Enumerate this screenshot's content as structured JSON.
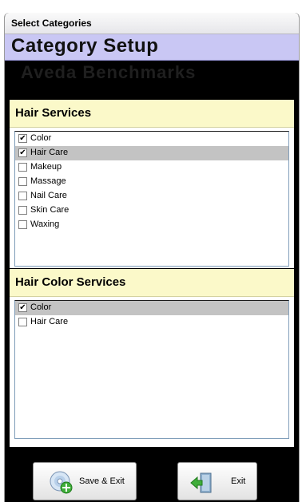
{
  "window": {
    "title": "Select Categories"
  },
  "header": {
    "title": "Category Setup",
    "subtitle": "Aveda Benchmarks"
  },
  "panels": [
    {
      "title": "Hair Services",
      "items": [
        {
          "label": "Color",
          "checked": true,
          "selected": false
        },
        {
          "label": "Hair Care",
          "checked": true,
          "selected": true
        },
        {
          "label": "Makeup",
          "checked": false,
          "selected": false
        },
        {
          "label": "Massage",
          "checked": false,
          "selected": false
        },
        {
          "label": "Nail Care",
          "checked": false,
          "selected": false
        },
        {
          "label": "Skin Care",
          "checked": false,
          "selected": false
        },
        {
          "label": "Waxing",
          "checked": false,
          "selected": false
        }
      ]
    },
    {
      "title": "Hair Color Services",
      "items": [
        {
          "label": "Color",
          "checked": true,
          "selected": true
        },
        {
          "label": "Hair Care",
          "checked": false,
          "selected": false
        }
      ]
    }
  ],
  "buttons": {
    "save_exit": {
      "label": "Save & Exit",
      "icon": "disc-add-icon"
    },
    "exit": {
      "label": "Exit",
      "icon": "exit-door-icon"
    }
  },
  "colors": {
    "header_band": "#c9c7f4",
    "panel_header": "#fbf9c9",
    "selected_row": "#c3c3c3",
    "background": "#000000"
  }
}
